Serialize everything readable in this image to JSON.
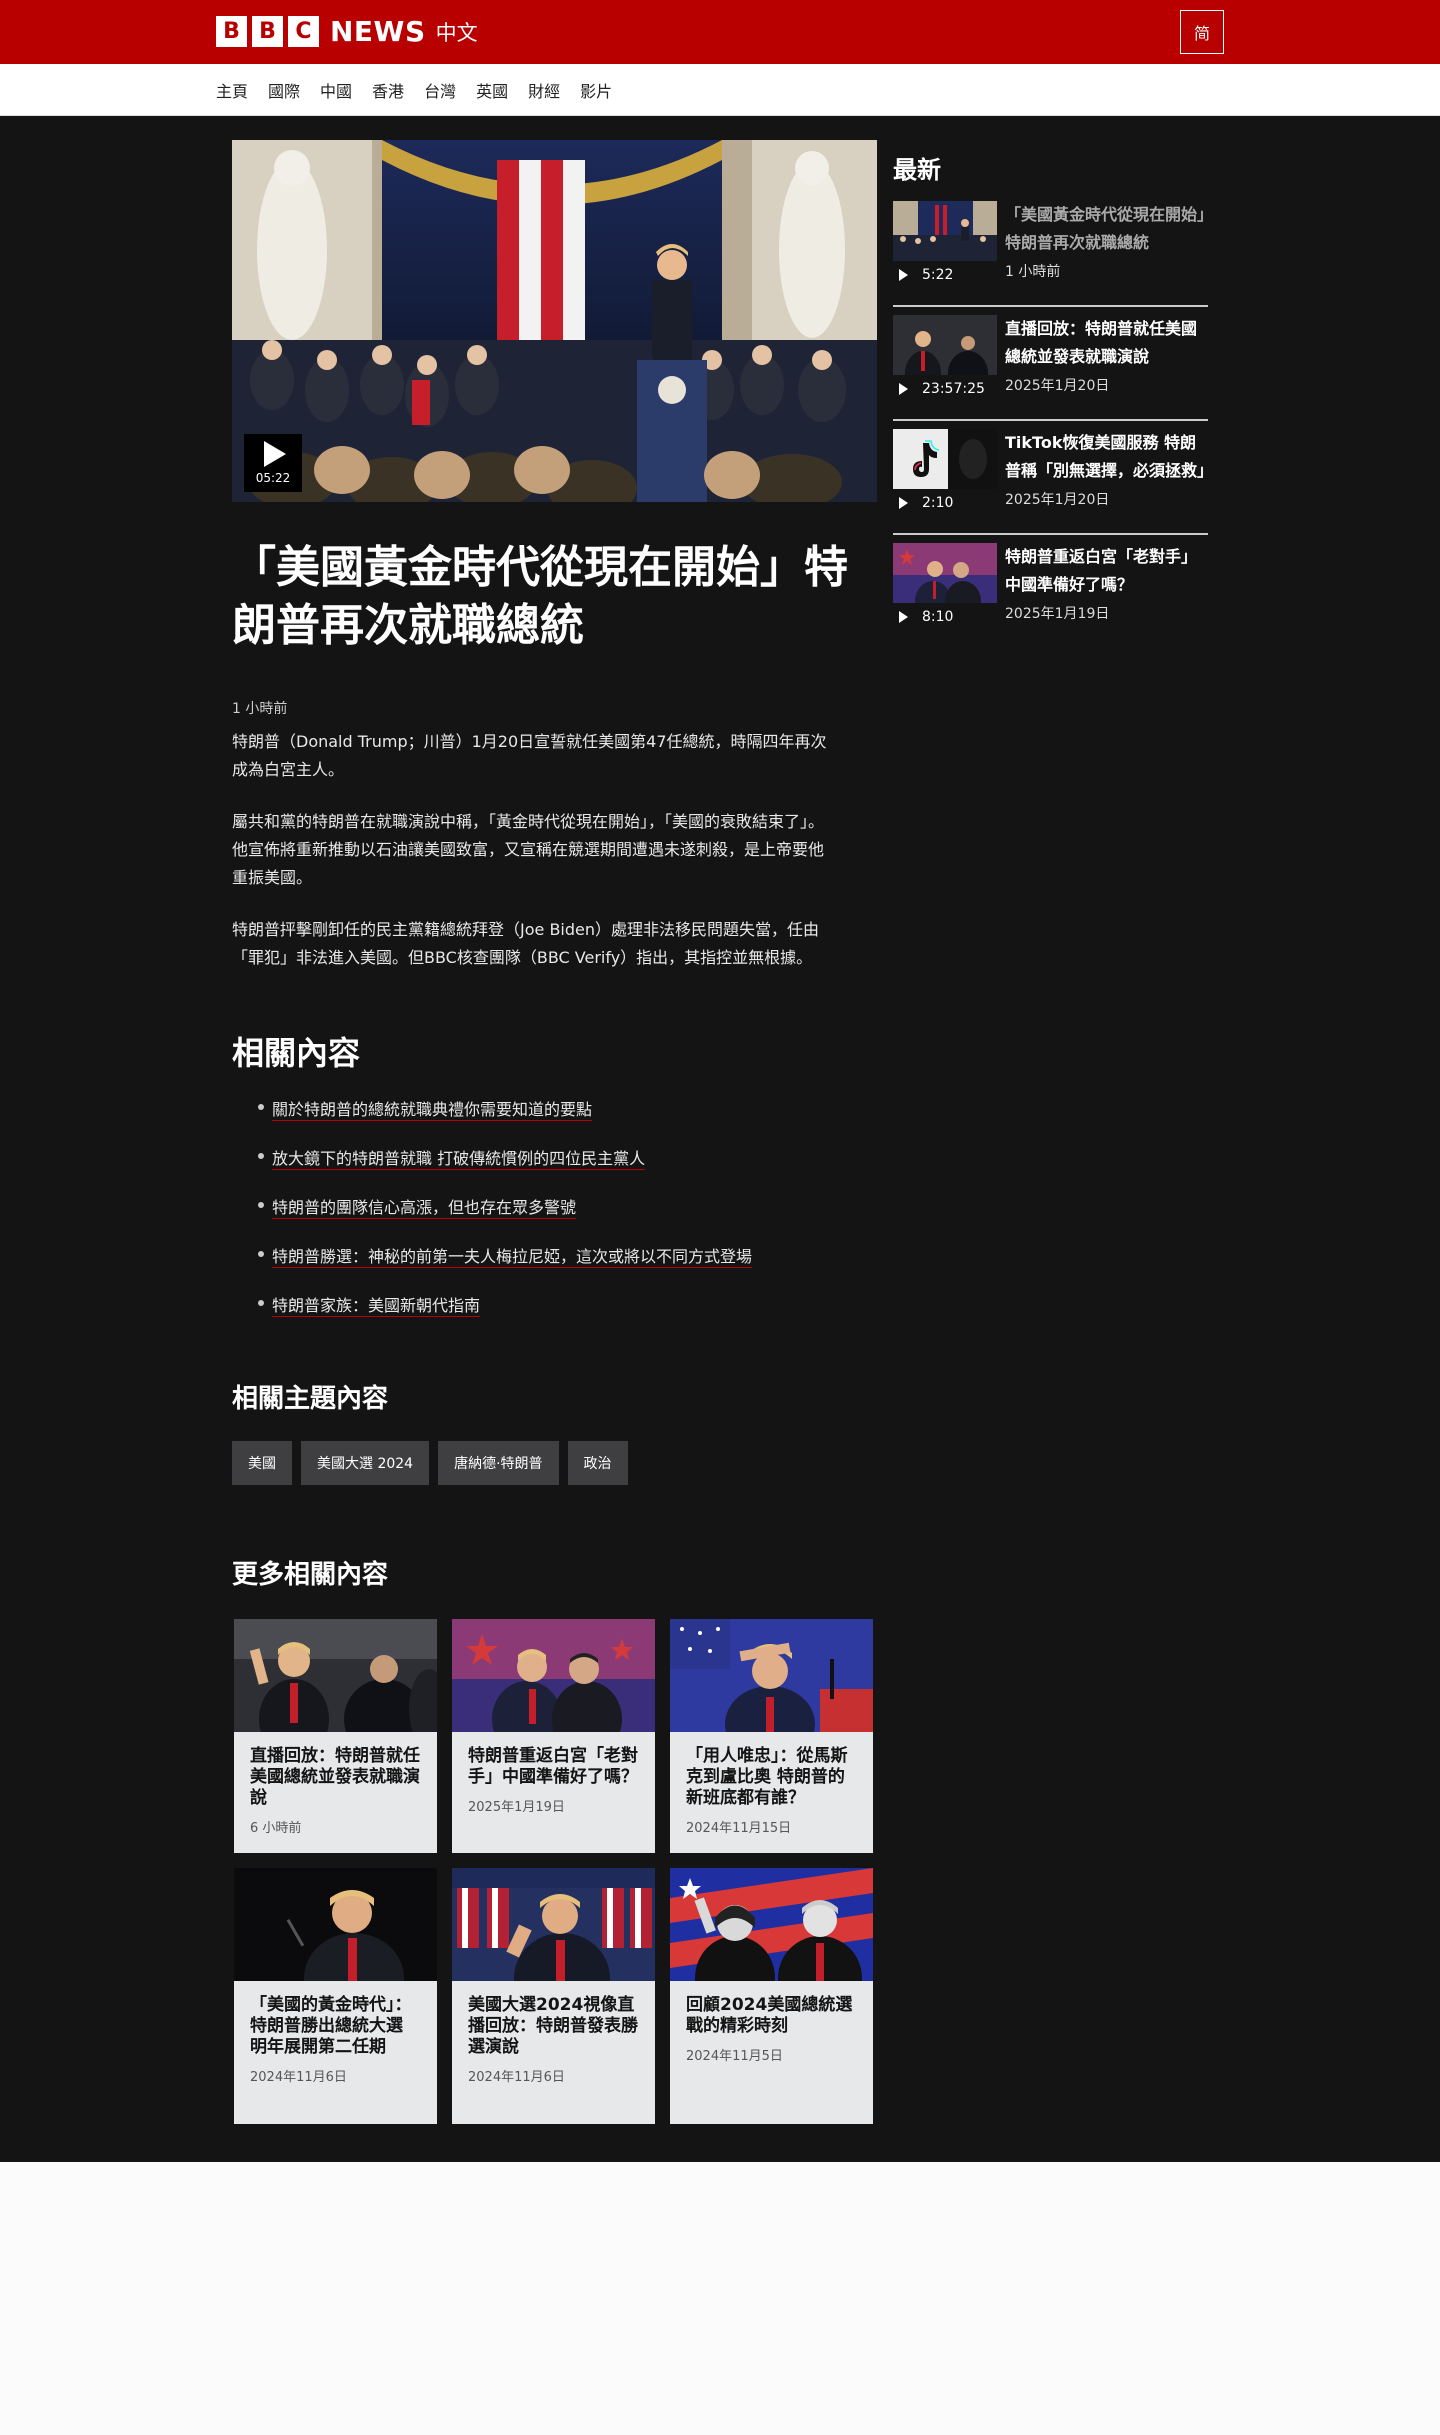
{
  "header": {
    "logo_letters": [
      "B",
      "B",
      "C"
    ],
    "logo_news": "NEWS",
    "logo_lang": "中文",
    "script_toggle": "简"
  },
  "nav": {
    "items": [
      "主頁",
      "國際",
      "中國",
      "香港",
      "台灣",
      "英國",
      "財經",
      "影片"
    ]
  },
  "article": {
    "video_duration": "05:22",
    "headline": "「美國黃金時代從現在開始」特朗普再次就職總統",
    "timestamp": "1 小時前",
    "paragraphs": [
      "特朗普（Donald Trump；川普）1月20日宣誓就任美國第47任總統，時隔四年再次成為白宮主人。",
      "屬共和黨的特朗普在就職演說中稱，「黃金時代從現在開始」，「美國的衰敗結束了」。他宣佈將重新推動以石油讓美國致富，又宣稱在競選期間遭遇未遂刺殺，是上帝要他重振美國。",
      "特朗普抨擊剛卸任的民主黨籍總統拜登（Joe Biden）處理非法移民問題失當，任由「罪犯」非法進入美國。但BBC核查團隊（BBC Verify）指出，其指控並無根據。"
    ]
  },
  "related": {
    "title": "相關內容",
    "items": [
      "關於特朗普的總統就職典禮你需要知道的要點",
      "放大鏡下的特朗普就職 打破傳統慣例的四位民主黨人",
      "特朗普的團隊信心高漲，但也存在眾多警號",
      "特朗普勝選：神秘的前第一夫人梅拉尼婭，這次或將以不同方式登場",
      "特朗普家族：美國新朝代指南"
    ]
  },
  "topics": {
    "title": "相關主題內容",
    "tags": [
      "美國",
      "美國大選 2024",
      "唐納德·特朗普",
      "政治"
    ]
  },
  "more": {
    "title": "更多相關內容",
    "cards": [
      {
        "title": "直播回放：特朗普就任美國總統並發表就職演說",
        "date": "6 小時前"
      },
      {
        "title": "特朗普重返白宮「老對手」中國準備好了嗎？",
        "date": "2025年1月19日"
      },
      {
        "title": "「用人唯忠」：從馬斯克到盧比奧 特朗普的新班底都有誰？",
        "date": "2024年11月15日"
      },
      {
        "title": "「美國的黃金時代」：特朗普勝出總統大選 明年展開第二任期",
        "date": "2024年11月6日"
      },
      {
        "title": "美國大選2024視像直播回放：特朗普發表勝選演說",
        "date": "2024年11月6日"
      },
      {
        "title": "回顧2024美國總統選戰的精彩時刻",
        "date": "2024年11月5日"
      }
    ]
  },
  "sidebar": {
    "title": "最新",
    "items": [
      {
        "title": "「美國黃金時代從現在開始」特朗普再次就職總統",
        "date": "1 小時前",
        "duration": "5:22"
      },
      {
        "title": "直播回放：特朗普就任美國總統並發表就職演說",
        "date": "2025年1月20日",
        "duration": "23:57:25"
      },
      {
        "title": "TikTok恢復美國服務 特朗普稱「別無選擇，必須拯救」",
        "date": "2025年1月20日",
        "duration": "2:10"
      },
      {
        "title": "特朗普重返白宮「老對手」中國準備好了嗎？",
        "date": "2025年1月19日",
        "duration": "8:10"
      }
    ]
  },
  "colors": {
    "brand_red": "#b80000",
    "page_dark": "#141414",
    "card_bg": "#e6e8ea",
    "tag_bg": "#3f3f42"
  }
}
